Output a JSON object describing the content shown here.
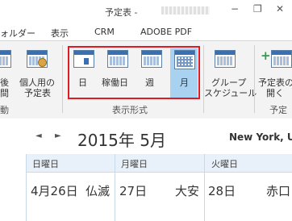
{
  "window": {
    "title": "予定表 -",
    "minimize": "−",
    "restore": "❐",
    "close": "✕"
  },
  "tabs": [
    "ォルダー",
    "表示",
    "CRM",
    "ADOBE PDF"
  ],
  "ribbon": {
    "partial_left_button": {
      "line1": "後",
      "line2": "間"
    },
    "personal_schedule": {
      "line1": "個人用の",
      "line2": "予定表"
    },
    "views": [
      {
        "label": "日",
        "selected": false
      },
      {
        "label": "稼働日",
        "selected": false
      },
      {
        "label": "週",
        "selected": false
      },
      {
        "label": "月",
        "selected": true
      }
    ],
    "group_schedule": {
      "line1": "グループ",
      "line2": "スケジュール"
    },
    "open_schedule": {
      "line1": "予定表の",
      "line2": "開く"
    },
    "group_labels": {
      "left_partial": "動",
      "arrange": "表示形式",
      "right_partial": "予定"
    },
    "highlight_color": "#e01b24",
    "selected_color": "#a9d1f0"
  },
  "calendar": {
    "prev": "◄",
    "next": "►",
    "year_month": "2015年 5月",
    "location": "New York, U",
    "day_names": [
      "日曜日",
      "月曜日",
      "火曜日"
    ],
    "dates": [
      {
        "date": "4月26日",
        "rokuyo": "仏滅"
      },
      {
        "date": "27日",
        "rokuyo": "大安"
      },
      {
        "date": "28日",
        "rokuyo": "赤口"
      }
    ]
  }
}
